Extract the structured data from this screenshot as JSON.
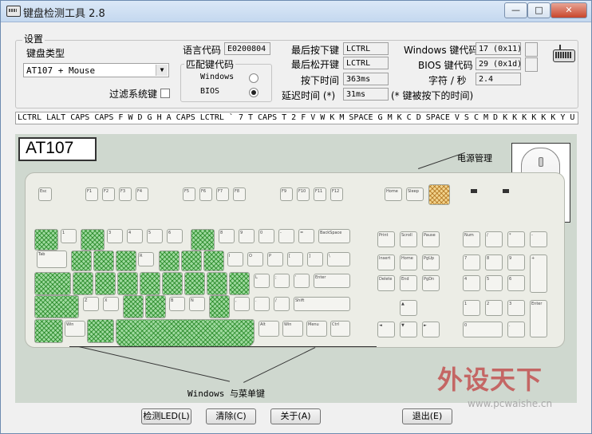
{
  "window": {
    "title": "键盘检测工具 2.8"
  },
  "titlebar_buttons": {
    "minimize": "—",
    "maximize": "□",
    "close": "✕"
  },
  "settings": {
    "group_label": "设置",
    "kb_type_label": "键盘类型",
    "kb_type_value": "AT107 + Mouse",
    "filter_label": "过滤系统键",
    "lang_code_label": "语言代码",
    "lang_code_value": "E0200804",
    "match_group_label": "匹配键代码",
    "match_windows": "Windows",
    "match_bios": "BIOS",
    "match_selected": "BIOS"
  },
  "status": {
    "last_down_label": "最后按下键",
    "last_down_value": "LCTRL",
    "last_up_label": "最后松开键",
    "last_up_value": "LCTRL",
    "press_time_label": "按下时间",
    "press_time_value": "363ms",
    "delay_label": "延迟时间 (*)",
    "delay_value": "31ms",
    "delay_note": "(* 键被按下的时间)",
    "win_code_label": "Windows 键代码",
    "win_code_value": "17 (0x11)",
    "bios_code_label": "BIOS 键代码",
    "bios_code_value": "29 (0x1d)",
    "rate_label": "字符 / 秒",
    "rate_value": "2.4"
  },
  "key_log": "LCTRL LALT CAPS CAPS F W D G H A CAPS LCTRL ` 7 T CAPS T 2 F V W K M SPACE G M K C D SPACE V S C M D K K K K K K Y U",
  "keyboard": {
    "model_label": "AT107",
    "power_label": "电源管理",
    "winmenu_label": "Windows 与菜单键",
    "highlight_color": "#9ed99e",
    "power_highlight_color": "#f1d38d"
  },
  "buttons": {
    "led": "检测LED(L)",
    "clear": "清除(C)",
    "about": "关于(A)",
    "exit": "退出(E)"
  },
  "watermark": {
    "main": "外设天下",
    "sub": "www.pcwaishe.cn"
  }
}
